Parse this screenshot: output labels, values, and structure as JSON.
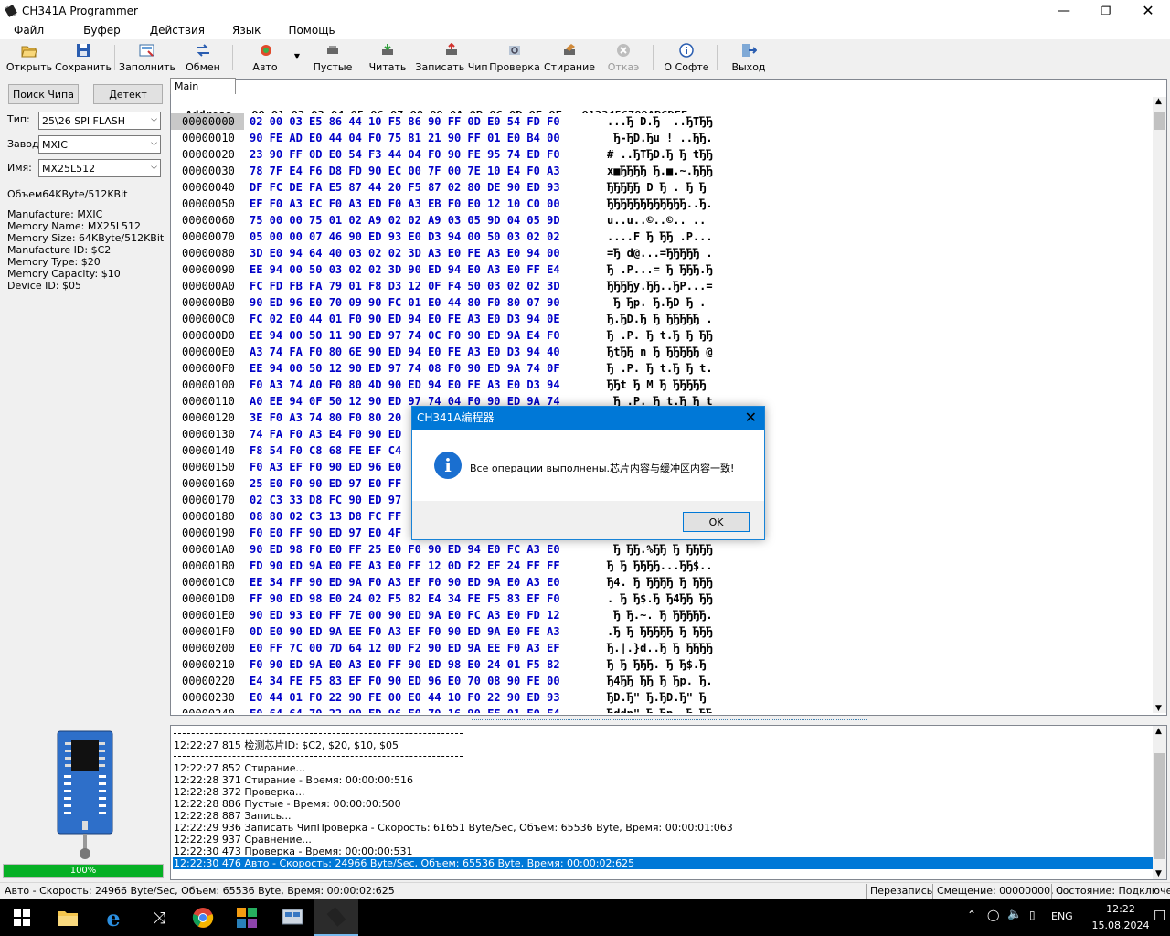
{
  "window": {
    "title": "CH341A Programmer"
  },
  "menu": [
    "Файл",
    "Буфер",
    "Действия",
    "Язык",
    "Помощь"
  ],
  "toolbar": [
    {
      "label": "Открыть",
      "icon": "open-folder-icon"
    },
    {
      "label": "Сохранить",
      "icon": "save-disk-icon"
    },
    {
      "label": "Заполнить",
      "icon": "fill-icon"
    },
    {
      "label": "Обмен",
      "icon": "swap-arrows-icon"
    },
    {
      "label": "Авто",
      "icon": "auto-icon"
    },
    {
      "label": "Пустые",
      "icon": "blank-check-icon"
    },
    {
      "label": "Читать",
      "icon": "read-chip-icon"
    },
    {
      "label": "Записать Чип",
      "icon": "write-chip-icon"
    },
    {
      "label": "Проверка",
      "icon": "verify-icon"
    },
    {
      "label": "Стирание",
      "icon": "erase-icon"
    },
    {
      "label": "Откаэ",
      "icon": "cancel-icon"
    },
    {
      "label": "О Софте",
      "icon": "info-icon"
    },
    {
      "label": "Выход",
      "icon": "exit-icon"
    }
  ],
  "left": {
    "search_btn": "Поиск Чипа",
    "detect_btn": "Детект",
    "type_label": "Тип:",
    "type_value": "25\\26 SPI FLASH",
    "maker_label": "Завод:",
    "maker_value": "MXIC",
    "name_label": "Имя:",
    "name_value": "MX25L512",
    "size_text": "Объем64KByte/512KBit",
    "info": [
      "Manufacture: MXIC",
      "Memory Name: MX25L512",
      "Memory Size: 64KByte/512KBit",
      "Manufacture ID: $C2",
      "Memory Type: $20",
      "Memory Capacity: $10",
      "Device ID: $05"
    ],
    "progress": "100%",
    "progress_value": 1.0
  },
  "hex": {
    "tab": "Main Memory",
    "header": "Address   00 01 02 03 04 05 06 07 08 09 0A 0B 0C 0D 0E 0F   0123456789ABCDEF",
    "rows": [
      {
        "a": "00000000",
        "h": "02 00 03 E5 86 44 10 F5 86 90 FF 0D E0 54 FD F0",
        "s": "...Ђ D.Ђ  ..ЂTЂЂ"
      },
      {
        "a": "00000010",
        "h": "90 FE AD E0 44 04 F0 75 81 21 90 FF 01 E0 B4 00",
        "s": " Ђ-ЂD.Ђu ! ..ЂЂ."
      },
      {
        "a": "00000020",
        "h": "23 90 FF 0D E0 54 F3 44 04 F0 90 FE 95 74 ED F0",
        "s": "# ..ЂTЂD.Ђ Ђ tЂЂ"
      },
      {
        "a": "00000030",
        "h": "78 7F E4 F6 D8 FD 90 EC 00 7F 00 7E 10 E4 F0 A3",
        "s": "x■ЂЂЂЂ Ђ.■.~.ЂЂЂ"
      },
      {
        "a": "00000040",
        "h": "DF FC DE FA E5 87 44 20 F5 87 02 80 DE 90 ED 93",
        "s": "ЂЂЂЂЂ D Ђ . Ђ Ђ"
      },
      {
        "a": "00000050",
        "h": "EF F0 A3 EC F0 A3 ED F0 A3 EB F0 E0 12 10 C0 00",
        "s": "ЂЂЂЂЂЂЂЂЂЂЂЂ..Ђ."
      },
      {
        "a": "00000060",
        "h": "75 00 00 75 01 02 A9 02 02 A9 03 05 9D 04 05 9D",
        "s": "u..u..©..©.. .."
      },
      {
        "a": "00000070",
        "h": "05 00 00 07 46 90 ED 93 E0 D3 94 00 50 03 02 02",
        "s": "....F Ђ ЂЂ .P..."
      },
      {
        "a": "00000080",
        "h": "3D E0 94 64 40 03 02 02 3D A3 E0 FE A3 E0 94 00",
        "s": "=Ђ d@...=ЂЂЂЂЂ ."
      },
      {
        "a": "00000090",
        "h": "EE 94 00 50 03 02 02 3D 90 ED 94 E0 A3 E0 FF E4",
        "s": "Ђ .P...= Ђ ЂЂЂ.Ђ"
      },
      {
        "a": "000000A0",
        "h": "FC FD FB FA 79 01 F8 D3 12 0F F4 50 03 02 02 3D",
        "s": "ЂЂЂЂy.ЂЂ..ЂP...="
      },
      {
        "a": "000000B0",
        "h": "90 ED 96 E0 70 09 90 FC 01 E0 44 80 F0 80 07 90",
        "s": " Ђ Ђp. Ђ.ЂD Ђ ."
      },
      {
        "a": "000000C0",
        "h": "FC 02 E0 44 01 F0 90 ED 94 E0 FE A3 E0 D3 94 0E",
        "s": "Ђ.ЂD.Ђ Ђ ЂЂЂЂЂ ."
      },
      {
        "a": "000000D0",
        "h": "EE 94 00 50 11 90 ED 97 74 0C F0 90 ED 9A E4 F0",
        "s": "Ђ .P. Ђ t.Ђ Ђ ЂЂ"
      },
      {
        "a": "000000E0",
        "h": "A3 74 FA F0 80 6E 90 ED 94 E0 FE A3 E0 D3 94 40",
        "s": "ЂtЂЂ n Ђ ЂЂЂЂЂ @"
      },
      {
        "a": "000000F0",
        "h": "EE 94 00 50 12 90 ED 97 74 08 F0 90 ED 9A 74 0F",
        "s": "Ђ .P. Ђ t.Ђ Ђ t."
      },
      {
        "a": "00000100",
        "h": "F0 A3 74 A0 F0 80 4D 90 ED 94 E0 FE A3 E0 D3 94",
        "s": "ЂЂt Ђ M Ђ ЂЂЂЂЂ"
      },
      {
        "a": "00000110",
        "h": "A0 EE 94 0F 50 12 90 ED 97 74 04 F0 90 ED 9A 74",
        "s": " Ђ .P. Ђ t.Ђ Ђ t"
      },
      {
        "a": "00000120",
        "h": "3E F0 A3 74 80 F0 80 20",
        "s": ""
      },
      {
        "a": "00000130",
        "h": "74 FA F0 A3 E4 F0 90 ED",
        "s": ""
      },
      {
        "a": "00000140",
        "h": "F8 54 F0 C8 68 FE EF C4",
        "s": ""
      },
      {
        "a": "00000150",
        "h": "F0 A3 EF F0 90 ED 96 E0",
        "s": ""
      },
      {
        "a": "00000160",
        "h": "25 E0 F0 90 ED 97 E0 FF",
        "s": ""
      },
      {
        "a": "00000170",
        "h": "02 C3 33 D8 FC 90 ED 97",
        "s": ""
      },
      {
        "a": "00000180",
        "h": "08 80 02 C3 13 D8 FC FF",
        "s": ""
      },
      {
        "a": "00000190",
        "h": "F0 E0 FF 90 ED 97 E0 4F",
        "s": ""
      },
      {
        "a": "000001A0",
        "h": "90 ED 98 F0 E0 FF 25 E0 F0 90 ED 94 E0 FC A3 E0",
        "s": " Ђ ЂЂ.%ЂЂ Ђ ЂЂЂЂ"
      },
      {
        "a": "000001B0",
        "h": "FD 90 ED 9A E0 FE A3 E0 FF 12 0D F2 EF 24 FF FF",
        "s": "Ђ Ђ ЂЂЂЂ...ЂЂ$.."
      },
      {
        "a": "000001C0",
        "h": "EE 34 FF 90 ED 9A F0 A3 EF F0 90 ED 9A E0 A3 E0",
        "s": "Ђ4. Ђ ЂЂЂЂ Ђ ЂЂЂ"
      },
      {
        "a": "000001D0",
        "h": "FF 90 ED 98 E0 24 02 F5 82 E4 34 FE F5 83 EF F0",
        "s": ". Ђ Ђ$.Ђ Ђ4ЂЂ ЂЂ"
      },
      {
        "a": "000001E0",
        "h": "90 ED 93 E0 FF 7E 00 90 ED 9A E0 FC A3 E0 FD 12",
        "s": " Ђ Ђ.~. Ђ ЂЂЂЂЂ."
      },
      {
        "a": "000001F0",
        "h": "0D E0 90 ED 9A EE F0 A3 EF F0 90 ED 9A E0 FE A3",
        "s": ".Ђ Ђ ЂЂЂЂЂ Ђ ЂЂЂ"
      },
      {
        "a": "00000200",
        "h": "E0 FF 7C 00 7D 64 12 0D F2 90 ED 9A EE F0 A3 EF",
        "s": "Ђ.|.}d..Ђ Ђ ЂЂЂЂ"
      },
      {
        "a": "00000210",
        "h": "F0 90 ED 9A E0 A3 E0 FF 90 ED 98 E0 24 01 F5 82",
        "s": "Ђ Ђ ЂЂЂ. Ђ Ђ$.Ђ"
      },
      {
        "a": "00000220",
        "h": "E4 34 FE F5 83 EF F0 90 ED 96 E0 70 08 90 FE 00",
        "s": "Ђ4ЂЂ ЂЂ Ђ Ђp. Ђ."
      },
      {
        "a": "00000230",
        "h": "E0 44 01 F0 22 90 FE 00 E0 44 10 F0 22 90 ED 93",
        "s": "ЂD.Ђ\" Ђ.ЂD.Ђ\" Ђ"
      },
      {
        "a": "00000240",
        "h": "F0 64 64 70 22 90 ED 96 E0 70 16 90 FE 01 E0 E4",
        "s": "Ђddp\" Ђ Ђp. Ђ.ЂЂ"
      }
    ]
  },
  "log": {
    "lines": [
      "12:22:27 815 检测芯片ID: $C2, $20, $10, $05",
      "12:22:27 852 Стирание...",
      "12:22:28 371 Стирание - Время: 00:00:00:516",
      "12:22:28 372 Проверка...",
      "12:22:28 886 Пустые - Время: 00:00:00:500",
      "12:22:28 887 Запись...",
      "12:22:29 936 Записать ЧипПроверка - Скорость: 61651 Byte/Sec, Объем: 65536 Byte, Время: 00:00:01:063",
      "12:22:29 937 Сравнение...",
      "12:22:30 473 Проверка - Время: 00:00:00:531",
      "12:22:30 476 Авто - Скорость: 24966 Byte/Sec, Объем: 65536 Byte, Время: 00:00:02:625"
    ]
  },
  "status": {
    "left": "Авто - Скорость: 24966 Byte/Sec, Объем: 65536 Byte, Время: 00:00:02:625",
    "mode": "Перезапись",
    "offset": "Смещение: 00000000, 0",
    "state": "Состояние: Подключен."
  },
  "dialog": {
    "title": "CH341A编程器",
    "message": "Все операции выполнены.芯片内容与缓冲区内容一致!",
    "ok": "OK"
  },
  "taskbar": {
    "lang": "ENG",
    "time": "12:22",
    "date": "15.08.2024"
  },
  "colors": {
    "accent": "#0078d7",
    "hex_text": "#0000c8",
    "progress": "#06b025"
  }
}
